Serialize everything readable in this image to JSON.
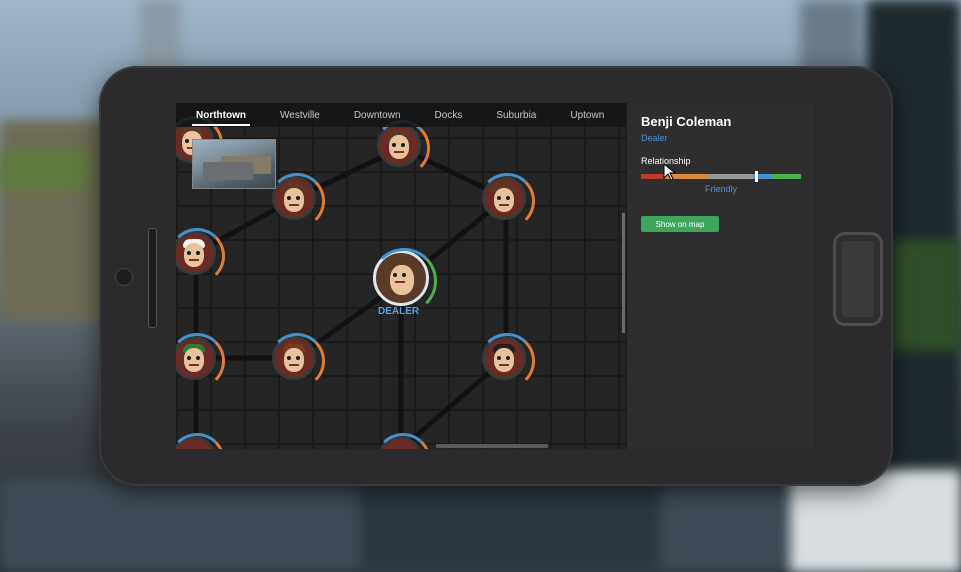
{
  "tabs": [
    {
      "label": "Northtown",
      "active": true
    },
    {
      "label": "Westville",
      "active": false
    },
    {
      "label": "Downtown",
      "active": false
    },
    {
      "label": "Docks",
      "active": false
    },
    {
      "label": "Suburbia",
      "active": false
    },
    {
      "label": "Uptown",
      "active": false
    }
  ],
  "map": {
    "dealer_label": "DEALER"
  },
  "contact": {
    "name": "Benji Coleman",
    "role": "Dealer",
    "relationship_label": "Relationship",
    "relationship_value": "Friendly",
    "relationship_level": 0.72,
    "show_on_map_label": "Show on map"
  },
  "colors": {
    "accent_blue": "#4a90d9",
    "button_green": "#3fa55a",
    "relationship_scale": [
      "#c0392b",
      "#d98a3c",
      "#9a9a9a",
      "#4a8fcf",
      "#4caf50"
    ]
  }
}
